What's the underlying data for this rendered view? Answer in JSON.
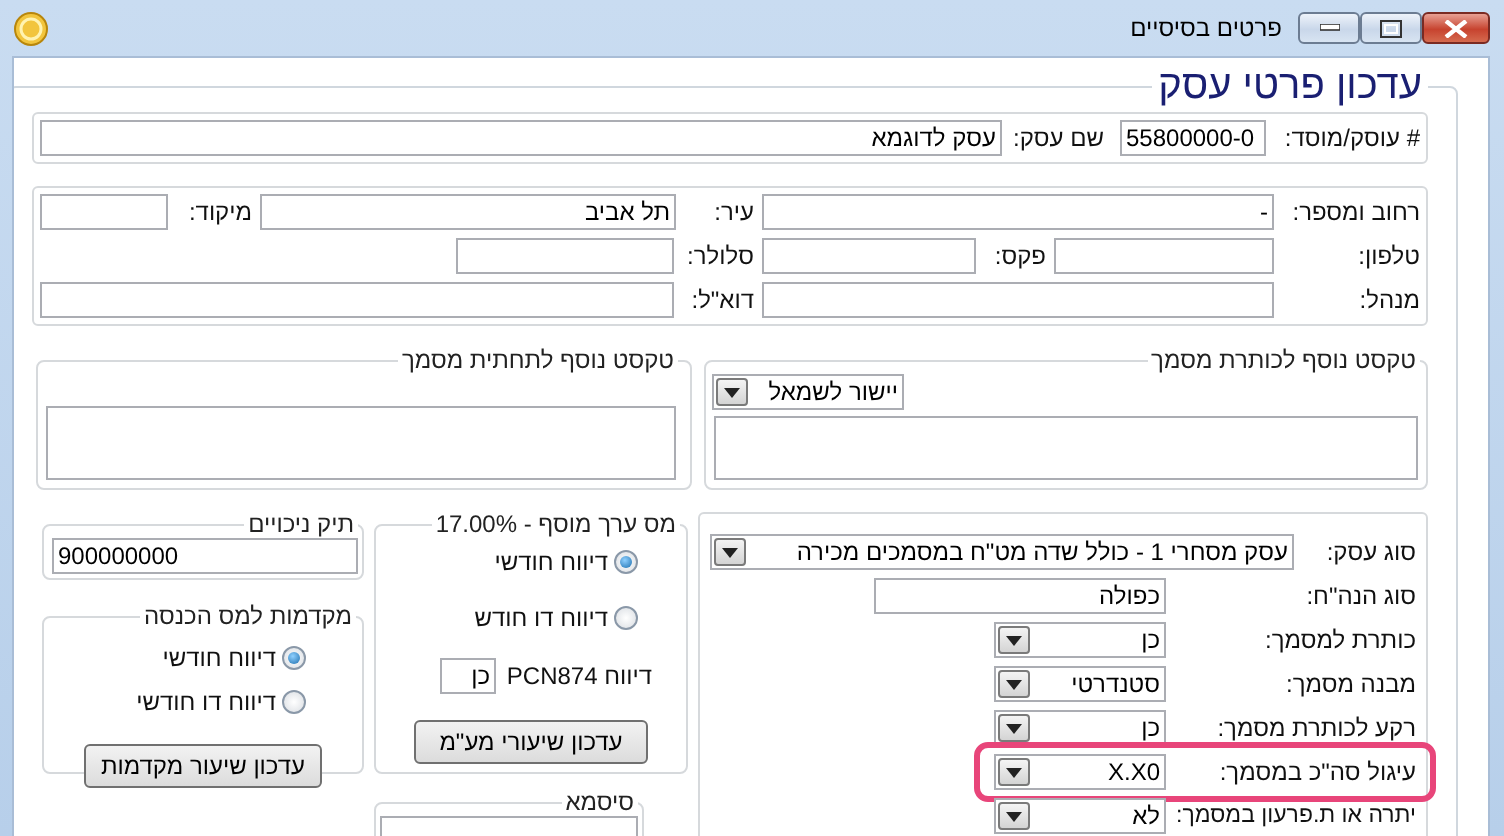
{
  "window": {
    "title": "פרטים בסיסיים"
  },
  "form_title": "עדכון פרטי עסק",
  "business": {
    "id_label": "# עוסק/מוסד:",
    "id_value": "55800000-0",
    "name_label": "שם עסק:",
    "name_value": "עסק לדוגמא"
  },
  "contact_rows": [
    [
      {
        "label": "רחוב ומספר:",
        "value": "-"
      },
      {
        "label": "עיר:",
        "value": "תל אביב"
      },
      {
        "label": "מיקוד:"
      }
    ],
    [
      {
        "label": "טלפון:"
      },
      {
        "label": "פקס:"
      },
      {
        "label": "סלולר:"
      }
    ],
    [
      {
        "label": "מנהל:"
      },
      {
        "label": "דוא\"ל:"
      }
    ]
  ],
  "header_text": {
    "title": "טקסט נוסף לכותרת מסמך",
    "alignment": "יישור לשמאל"
  },
  "footer_text": {
    "title": "טקסט נוסף לתחתית מסמך"
  },
  "document_settings": [
    {
      "kind": "select",
      "label": "סוג עסק:",
      "value": "עסק מסחרי 1 - כולל שדה מט\"ח במסמכים מכירה",
      "highlighted": false
    },
    {
      "kind": "input",
      "label": "סוג הנה\"ח:",
      "value": "כפולה",
      "highlighted": false
    },
    {
      "kind": "select",
      "label": "כותרת למסמך:",
      "value": "כן",
      "highlighted": false
    },
    {
      "kind": "select",
      "label": "מבנה מסמך:",
      "value": "סטנדרטי",
      "highlighted": false
    },
    {
      "kind": "select",
      "label": "רקע לכותרת מסמך:",
      "value": "כן",
      "highlighted": false
    },
    {
      "kind": "select",
      "label": "עיגול סה\"כ במסמך:",
      "value": "X.X0",
      "highlighted": true
    },
    {
      "kind": "select",
      "label": "יתרה או ת.פרעון במסמך:",
      "value": "לא",
      "highlighted": false
    }
  ],
  "vat": {
    "title": "מס ערך מוסף - 17.00%",
    "options": [
      {
        "label": "דיווח חודשי",
        "selected": true
      },
      {
        "label": "דיווח דו חודש",
        "selected": false
      }
    ],
    "pcn_label": "דיווח PCN874",
    "pcn_value": "כן",
    "button": "עדכון שיעורי מע\"מ"
  },
  "withholding": {
    "title": "תיק ניכויים",
    "value": "900000000"
  },
  "advances": {
    "title": "מקדמות למס הכנסה",
    "options": [
      {
        "label": "דיווח חודשי",
        "selected": true
      },
      {
        "label": "דיווח דו חודשי",
        "selected": false
      }
    ],
    "button": "עדכון שיעור מקדמות"
  },
  "password": {
    "title": "סיסמא"
  }
}
